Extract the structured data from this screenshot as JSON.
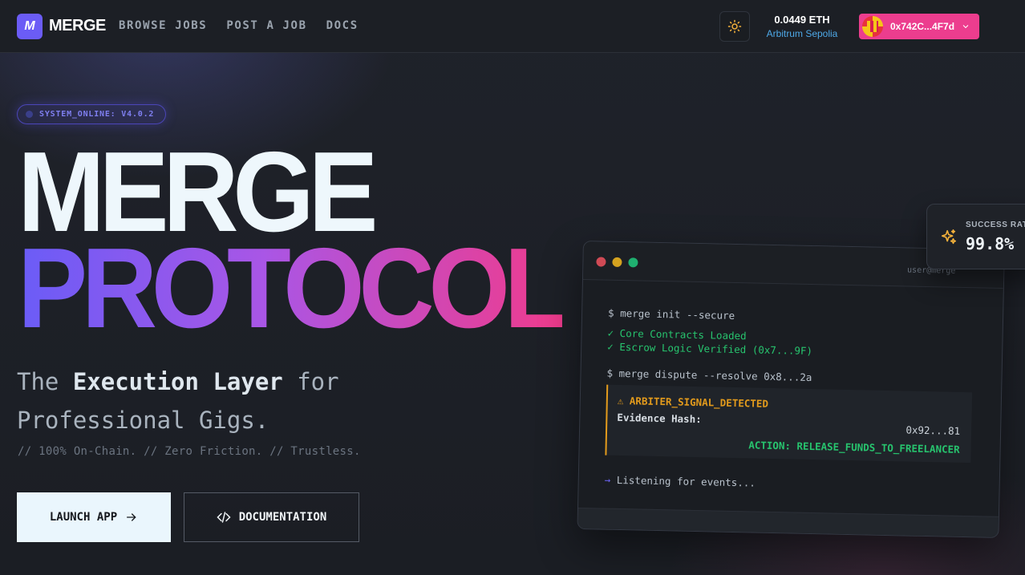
{
  "nav": {
    "logo_mark": "M",
    "logo_text": "MERGE",
    "links": [
      "BROWSE JOBS",
      "POST A JOB",
      "DOCS"
    ],
    "theme_icon": "sun-icon",
    "balance": "0.0449 ETH",
    "network": "Arbitrum Sepolia",
    "wallet_address": "0x742C...4F7d",
    "wallet_color": "#ec3d8e"
  },
  "hero": {
    "badge": "SYSTEM_ONLINE: V4.0.2",
    "title_line1": "MERGE",
    "title_line2": "PROTOCOL",
    "tagline_pre": "The ",
    "tagline_bold": "Execution Layer",
    "tagline_post": " for Professional Gigs.",
    "subline": "// 100% On-Chain. // Zero Friction. // Trustless.",
    "primary_button": "LAUNCH APP",
    "secondary_button": "DOCUMENTATION",
    "accent_gradient": [
      "#6a5cf7",
      "#a956e6",
      "#f03b8c"
    ]
  },
  "terminal": {
    "user": "user@merge",
    "lines": {
      "cmd1": "$ merge init --secure",
      "ok1": "✓ Core Contracts Loaded",
      "ok2": "✓ Escrow Logic Verified (0x7...9F)",
      "cmd2": "$ merge dispute --resolve 0x8...2a",
      "alert_title": "⚠ ARBITER_SIGNAL_DETECTED",
      "alert_hash_label": "Evidence Hash:",
      "alert_hash": "0x92...81",
      "alert_action": "ACTION: RELEASE_FUNDS_TO_FREELANCER",
      "listening_arrow": "→",
      "listening": " Listening for events..."
    }
  },
  "success": {
    "label": "SUCCESS RATE",
    "value": "99.8%"
  }
}
